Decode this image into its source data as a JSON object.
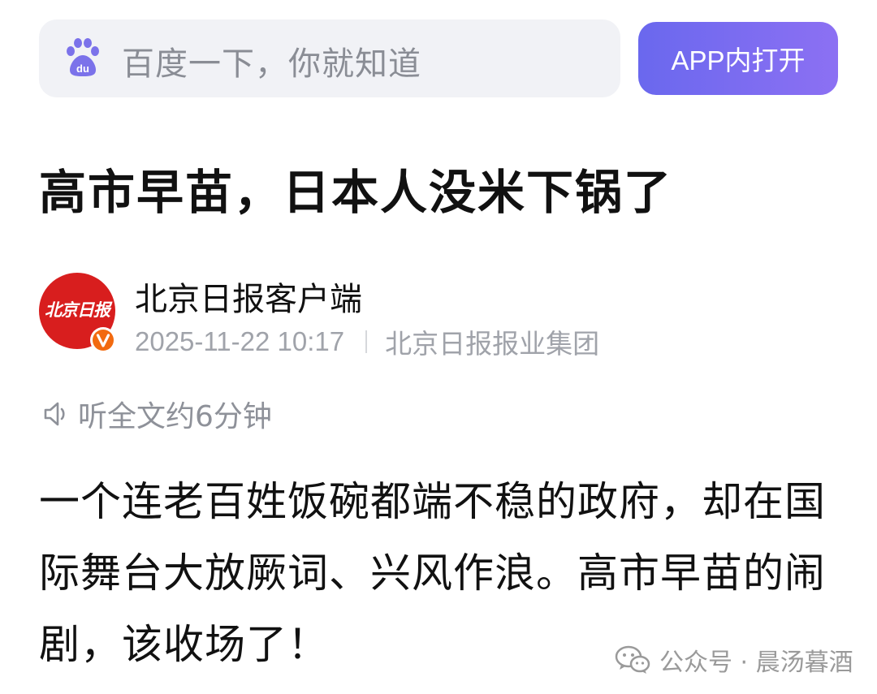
{
  "header": {
    "search_placeholder": "百度一下，你就知道",
    "app_button_label": "APP内打开"
  },
  "article": {
    "title": "高市早苗，日本人没米下锅了",
    "author": {
      "avatar_text": "北京日报",
      "name": "北京日报客户端",
      "datetime": "2025-11-22 10:17",
      "source": "北京日报报业集团"
    },
    "listen_label": "听全文约6分钟",
    "body": "一个连老百姓饭碗都端不稳的政府，却在国际舞台大放厥词、兴风作浪。高市早苗的闹剧，该收场了！"
  },
  "watermark": {
    "text": "公众号 · 晨汤暮酒"
  },
  "colors": {
    "accent": "#7a6cf0",
    "avatar_red": "#d81e1e",
    "search_bg": "#f1f2f6"
  }
}
